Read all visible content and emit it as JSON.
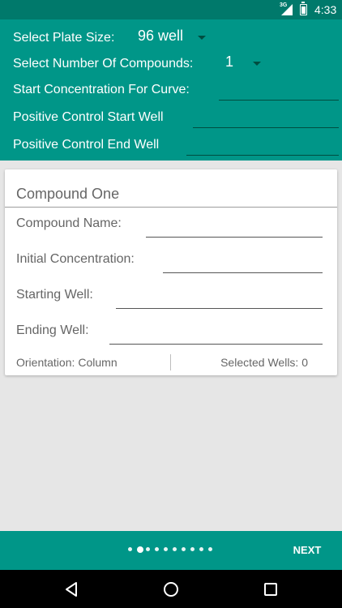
{
  "status_bar": {
    "network_label": "3G",
    "time": "4:33"
  },
  "form": {
    "plate_size": {
      "label": "Select Plate Size:",
      "value": "96 well"
    },
    "compound_count": {
      "label": "Select Number Of Compounds:",
      "value": "1"
    },
    "start_concentration": {
      "label": "Start Concentration For Curve:",
      "value": ""
    },
    "positive_start": {
      "label": "Positive Control Start Well",
      "value": ""
    },
    "positive_end": {
      "label": "Positive Control End Well",
      "value": ""
    }
  },
  "compound_card": {
    "title": "Compound One",
    "fields": [
      {
        "label": "Compound Name:",
        "value": ""
      },
      {
        "label": "Initial Concentration:",
        "value": ""
      },
      {
        "label": "Starting Well:",
        "value": ""
      },
      {
        "label": "Ending Well:",
        "value": ""
      }
    ],
    "orientation_label": "Orientation:",
    "orientation_value": "Column",
    "selected_wells": "Selected Wells: 0"
  },
  "pager": {
    "page_count": 10,
    "current_page": 2,
    "next_label": "NEXT"
  },
  "nav": {
    "icons": [
      "back-icon",
      "home-icon",
      "recents-icon"
    ]
  },
  "colors": {
    "primary": "#009688",
    "primary_dark": "#00796b",
    "underline": "#004d40",
    "background": "#e6e6e6"
  }
}
